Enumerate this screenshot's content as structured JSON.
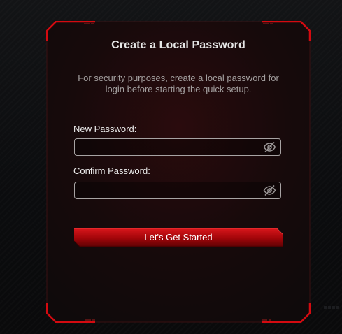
{
  "dialog": {
    "title": "Create a Local Password",
    "description": "For security purposes, create a local password for login before starting the quick setup.",
    "new_password": {
      "label": "New Password:",
      "value": "",
      "visibility_icon": "eye-slash-icon"
    },
    "confirm_password": {
      "label": "Confirm Password:",
      "value": "",
      "visibility_icon": "eye-slash-icon"
    },
    "submit_label": "Let's Get Started"
  },
  "colors": {
    "accent": "#c4070b",
    "accent_dark": "#6b0205",
    "panel_bg": "#1a0a0b",
    "page_bg": "#0b0c0e",
    "text_primary": "#e6e6e6",
    "text_muted": "#a39f9f"
  }
}
